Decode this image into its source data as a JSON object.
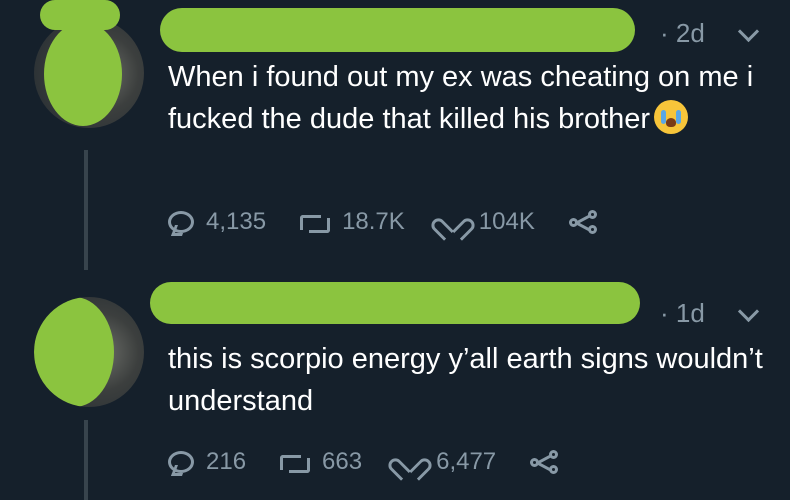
{
  "tweets": [
    {
      "timestamp": "· 2d",
      "text": "When i found out my ex was cheating on me i fucked the dude that killed his brother",
      "emoji": "crying-face",
      "replies": "4,135",
      "retweets": "18.7K",
      "likes": "104K"
    },
    {
      "timestamp": "· 1d",
      "text": "this is scorpio energy y’all earth signs wouldn’t understand",
      "replies": "216",
      "retweets": "663",
      "likes": "6,477"
    }
  ],
  "colors": {
    "background": "#15202b",
    "muted": "#8899a6",
    "redaction": "#8bc43f",
    "text": "#ffffff"
  },
  "icons": [
    "reply-icon",
    "retweet-icon",
    "like-icon",
    "share-icon",
    "chevron-down-icon"
  ]
}
